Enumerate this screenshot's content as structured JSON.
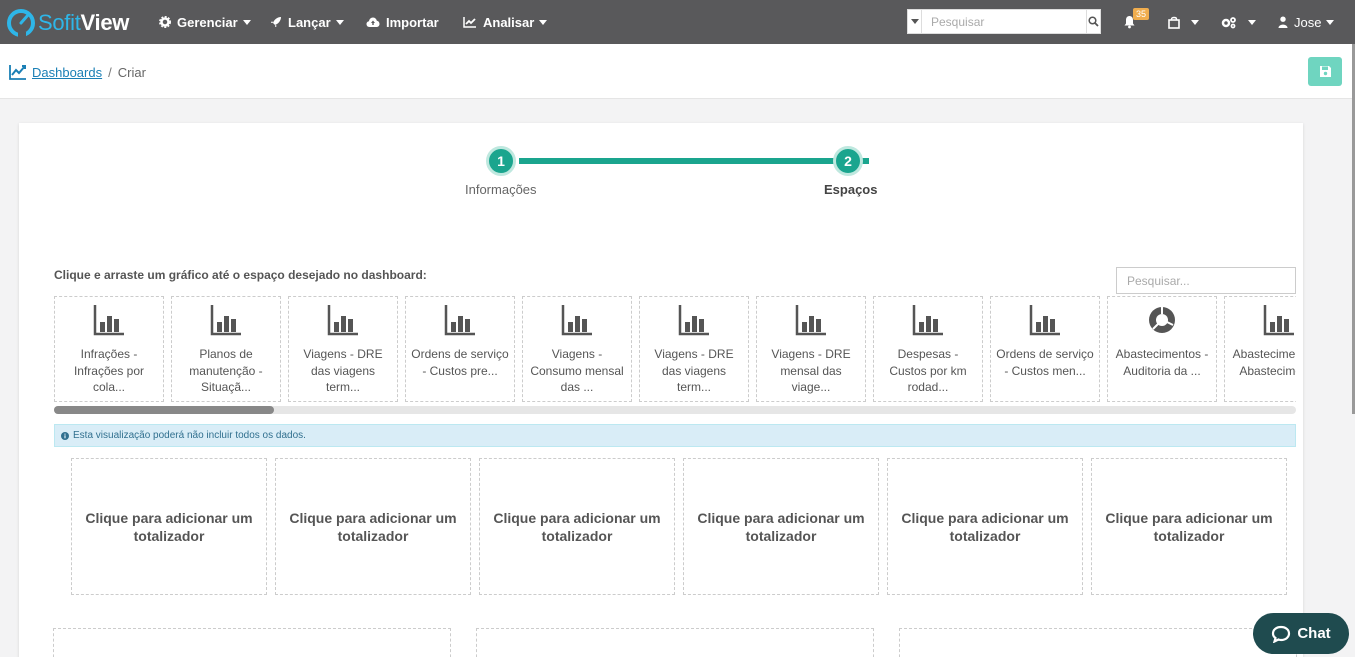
{
  "brand": {
    "soft": "Sofit",
    "view": "View",
    "accent": "#2eb6e8"
  },
  "nav": {
    "gerenciar": "Gerenciar",
    "lancar": "Lançar",
    "importar": "Importar",
    "analisar": "Analisar",
    "search_placeholder": "Pesquisar",
    "notifications_count": "35",
    "user": "Jose"
  },
  "breadcrumb": {
    "dashboards": "Dashboards",
    "sep": "/",
    "current": "Criar"
  },
  "stepper": {
    "steps": [
      {
        "number": "1",
        "label": "Informações"
      },
      {
        "number": "2",
        "label": "Espaços"
      }
    ],
    "color": "#1aa58e"
  },
  "charts": {
    "instruction": "Clique e arraste um gráfico até o espaço desejado no dashboard:",
    "search_placeholder": "Pesquisar...",
    "items": [
      {
        "icon": "bar-chart-icon",
        "label": "Infrações - Infrações por cola..."
      },
      {
        "icon": "bar-chart-icon",
        "label": "Planos de manutenção - Situaçã..."
      },
      {
        "icon": "bar-chart-icon",
        "label": "Viagens - DRE das viagens term..."
      },
      {
        "icon": "bar-chart-icon",
        "label": "Ordens de serviço - Custos pre..."
      },
      {
        "icon": "bar-chart-icon",
        "label": "Viagens - Consumo mensal das ..."
      },
      {
        "icon": "bar-chart-icon",
        "label": "Viagens - DRE das viagens term..."
      },
      {
        "icon": "bar-chart-icon",
        "label": "Viagens - DRE mensal das viage..."
      },
      {
        "icon": "bar-chart-icon",
        "label": "Despesas - Custos por km rodad..."
      },
      {
        "icon": "bar-chart-icon",
        "label": "Ordens de serviço - Custos men..."
      },
      {
        "icon": "pie-chart-icon",
        "label": "Abastecimentos - Auditoria da ..."
      },
      {
        "icon": "bar-chart-icon",
        "label": "Abastecimentos - Abastecimen..."
      }
    ]
  },
  "alert": "Esta visualização poderá não incluir todos os dados.",
  "totalizers": [
    "Clique para adicionar um totalizador",
    "Clique para adicionar um totalizador",
    "Clique para adicionar um totalizador",
    "Clique para adicionar um totalizador",
    "Clique para adicionar um totalizador",
    "Clique para adicionar um totalizador"
  ],
  "chat": "Chat"
}
